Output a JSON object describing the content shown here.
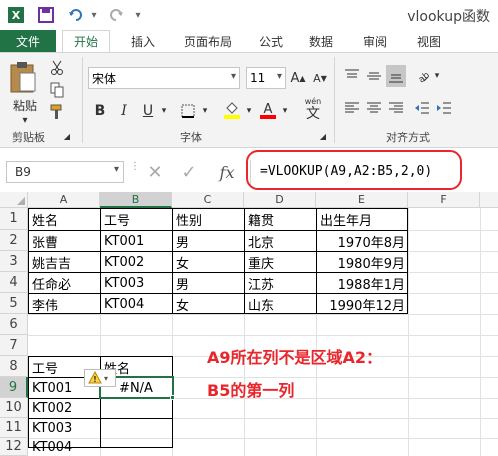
{
  "window": {
    "title": "vlookup函数"
  },
  "tabs": [
    "文件",
    "开始",
    "插入",
    "页面布局",
    "公式",
    "数据",
    "审阅",
    "视图"
  ],
  "ribbon": {
    "paste_label": "粘贴",
    "clipboard_group": "剪贴板",
    "font_group": "字体",
    "align_group": "对齐方式",
    "font_name": "宋体",
    "font_size": "11",
    "bold": "B",
    "italic": "I",
    "underline": "U",
    "wen": "wén"
  },
  "formula_bar": {
    "name_box": "B9",
    "fx": "fx",
    "formula": "=VLOOKUP(A9,A2:B5,2,0)"
  },
  "columns": [
    "A",
    "B",
    "C",
    "D",
    "E",
    "F"
  ],
  "rows": [
    "1",
    "2",
    "3",
    "4",
    "5",
    "6",
    "7",
    "8",
    "9",
    "10",
    "11",
    "12"
  ],
  "table1": {
    "headers": [
      "姓名",
      "工号",
      "性别",
      "籍贯",
      "出生年月"
    ],
    "rows": [
      [
        "张曹",
        "KT001",
        "男",
        "北京",
        "1970年8月"
      ],
      [
        "姚吉吉",
        "KT002",
        "女",
        "重庆",
        "1980年9月"
      ],
      [
        "任命必",
        "KT003",
        "男",
        "江苏",
        "1988年1月"
      ],
      [
        "李伟",
        "KT004",
        "女",
        "山东",
        "1990年12月"
      ]
    ]
  },
  "table2": {
    "headers": [
      "工号",
      "姓名"
    ],
    "ids": [
      "KT001",
      "KT002",
      "KT003",
      "KT004"
    ],
    "result": "#N/A"
  },
  "annotation": {
    "line1": "A9所在列不是区域A2：",
    "line2": "B5的第一列"
  },
  "colors": {
    "excel_green": "#217346",
    "annotation_red": "#e8262b"
  }
}
